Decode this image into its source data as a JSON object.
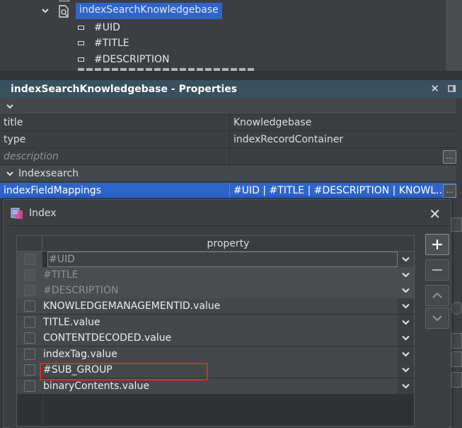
{
  "tree": {
    "selected_node": "indexSearchKnowledgebase",
    "fields": [
      "#UID",
      "#TITLE",
      "#DESCRIPTION"
    ],
    "icons": {
      "expand": "chevron-down-icon",
      "node": "document-search-icon",
      "field": "field-icon"
    }
  },
  "properties": {
    "title": "indexSearchKnowledgebase - Properties",
    "header_icons": {
      "close": "✕",
      "pin": "pin-icon"
    },
    "rows": [
      {
        "key": "title",
        "value": "Knowledgebase"
      },
      {
        "key": "type",
        "value": "indexRecordContainer"
      },
      {
        "key": "description",
        "value": ""
      }
    ],
    "group_label": "Indexsearch",
    "mapping": {
      "key": "indexFieldMappings",
      "value": "#UID | #TITLE | #DESCRIPTION | KNOWL..."
    },
    "dots_label": "..."
  },
  "dialog": {
    "title": "Index",
    "close_label": "✕",
    "column_header": "property",
    "rows": [
      {
        "value": "#UID",
        "state": "combo"
      },
      {
        "value": "#TITLE",
        "state": "disabled"
      },
      {
        "value": "#DESCRIPTION",
        "state": "disabled"
      },
      {
        "value": "KNOWLEDGEMANAGEMENTID.value",
        "state": "normal"
      },
      {
        "value": "TITLE.value",
        "state": "normal"
      },
      {
        "value": "CONTENTDECODED.value",
        "state": "normal"
      },
      {
        "value": "indexTag.value",
        "state": "normal"
      },
      {
        "value": "#SUB_GROUP",
        "state": "highlighted"
      },
      {
        "value": "binaryContents.value",
        "state": "normal"
      }
    ],
    "buttons": {
      "add": "plus-icon",
      "remove": "minus-icon",
      "up": "chevron-up-icon",
      "down": "chevron-down-icon"
    }
  },
  "colors": {
    "selection": "#2f65ca",
    "header": "#39505f",
    "highlight": "#d0302c"
  }
}
